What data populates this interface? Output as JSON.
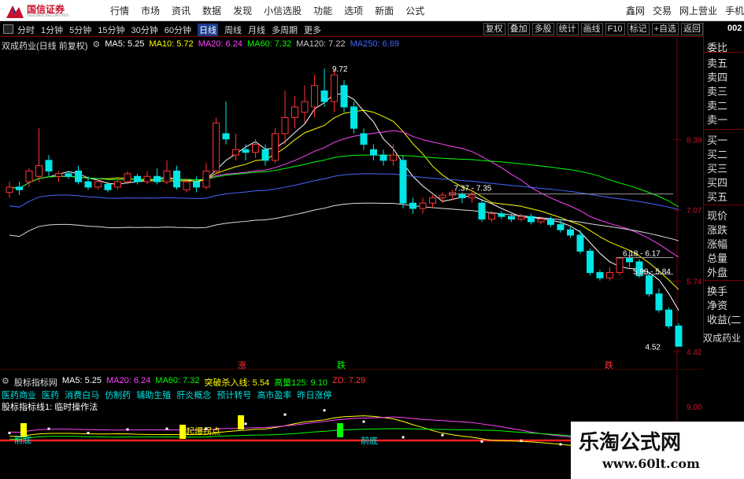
{
  "app": {
    "logo_name": "国信证券",
    "logo_sub": "GUOSEN SECURITIES",
    "main_menu": [
      "行情",
      "市场",
      "资讯",
      "数据",
      "发现",
      "小信选股",
      "功能",
      "选项",
      "新面",
      "公式"
    ],
    "right_menu": [
      "鑫网",
      "交易",
      "网上营业",
      "手机"
    ]
  },
  "toolbar": {
    "periods": [
      "分时",
      "1分钟",
      "5分钟",
      "15分钟",
      "30分钟",
      "60分钟",
      "日线",
      "周线",
      "月线",
      "多周期",
      "更多"
    ],
    "active_period": "日线",
    "tools": [
      "复权",
      "叠加",
      "多股",
      "统计",
      "画线",
      "F10",
      "标记",
      "+自选",
      "返回"
    ]
  },
  "main_chart": {
    "stock_title": "双成药业(日线 前复权)",
    "ma_labels": [
      {
        "text": "MA5: 5.25",
        "color": "#ffffff"
      },
      {
        "text": "MA10: 5.72",
        "color": "#ffff00"
      },
      {
        "text": "MA20: 6.24",
        "color": "#ff44ff"
      },
      {
        "text": "MA60: 7.32",
        "color": "#00ff00"
      },
      {
        "text": "MA120: 7.22",
        "color": "#cccccc"
      },
      {
        "text": "MA250: 6.69",
        "color": "#4466ff"
      }
    ],
    "price_axis": [
      "8.39",
      "7.07",
      "5.74",
      "4.42"
    ],
    "annotations": {
      "high": "9.72",
      "low": "4.52",
      "range1": "7.37 - 7.35",
      "range2": "6.18 - 6.17",
      "range3": "5.90 - 5.84"
    },
    "markers": [
      {
        "text": "涨",
        "color": "#ff3333"
      },
      {
        "text": "跌",
        "color": "#00ff00"
      },
      {
        "text": "跌",
        "color": "#ff3333"
      }
    ]
  },
  "quote_panel": {
    "code": "002",
    "labels": [
      "委比",
      "卖五",
      "卖四",
      "卖三",
      "卖二",
      "卖一",
      "买一",
      "买二",
      "买三",
      "买四",
      "买五",
      "现价",
      "涨跌",
      "涨幅",
      "总量",
      "外盘",
      "换手",
      "净资",
      "收益(二"
    ],
    "stock_name": "双成药业"
  },
  "indicator": {
    "title": "股标指标网",
    "legend": [
      {
        "text": "MA5: 5.25",
        "color": "#ffffff"
      },
      {
        "text": "MA20: 6.24",
        "color": "#ff44ff"
      },
      {
        "text": "MA60: 7.32",
        "color": "#00ff00"
      },
      {
        "text": "突破杀入线: 5.54",
        "color": "#ffff00"
      },
      {
        "text": "高量125: 9.10",
        "color": "#00ff00"
      },
      {
        "text": "ZD: 7.29",
        "color": "#ff3333"
      }
    ],
    "concept_tags": [
      "医药商业",
      "医药",
      "消费白马",
      "仿制药",
      "辅助生殖",
      "肝炎概念",
      "预计转号",
      "高市盈率",
      "昨日涨停"
    ],
    "line_title": "股标指标线1: 临时操作法",
    "axis_top": "9.00",
    "labels": {
      "start": "起爆拐点",
      "bottom1": "前底",
      "bottom2": "前底"
    }
  },
  "watermark": {
    "title": "乐淘公式网",
    "url": "www.60lt.com"
  },
  "chart_data": {
    "type": "candlestick",
    "title": "双成药业(日线 前复权)",
    "ylim": [
      4.2,
      10.0
    ],
    "yticks": [
      8.39,
      7.07,
      5.74,
      4.42
    ],
    "candles": [
      [
        7.4,
        7.5,
        7.3,
        7.6
      ],
      [
        7.5,
        7.45,
        7.35,
        7.6
      ],
      [
        7.6,
        7.8,
        7.5,
        7.85
      ],
      [
        7.7,
        7.9,
        7.6,
        8.6
      ],
      [
        8.0,
        7.8,
        7.7,
        8.1
      ],
      [
        7.7,
        7.75,
        7.6,
        7.8
      ],
      [
        7.75,
        7.7,
        7.65,
        7.8
      ],
      [
        7.8,
        7.6,
        7.55,
        7.9
      ],
      [
        7.6,
        7.5,
        7.45,
        7.7
      ],
      [
        7.5,
        7.6,
        7.45,
        7.65
      ],
      [
        7.55,
        7.45,
        7.4,
        7.6
      ],
      [
        7.5,
        7.6,
        7.45,
        7.65
      ],
      [
        7.6,
        7.75,
        7.55,
        7.8
      ],
      [
        7.7,
        7.6,
        7.55,
        7.75
      ],
      [
        7.6,
        7.7,
        7.55,
        7.8
      ],
      [
        7.7,
        7.6,
        7.55,
        7.85
      ],
      [
        7.6,
        7.8,
        7.55,
        8.0
      ],
      [
        7.8,
        7.5,
        7.45,
        7.9
      ],
      [
        7.45,
        7.6,
        7.4,
        7.65
      ],
      [
        7.6,
        7.5,
        7.4,
        7.7
      ],
      [
        7.5,
        7.8,
        7.45,
        7.95
      ],
      [
        7.8,
        8.7,
        7.75,
        8.8
      ],
      [
        8.5,
        8.4,
        8.3,
        9.1
      ],
      [
        8.1,
        8.2,
        8.0,
        8.5
      ],
      [
        8.2,
        8.15,
        8.0,
        8.3
      ],
      [
        8.15,
        8.3,
        8.05,
        8.4
      ],
      [
        8.2,
        8.0,
        7.9,
        8.3
      ],
      [
        8.0,
        8.5,
        7.95,
        8.6
      ],
      [
        8.5,
        8.8,
        8.3,
        9.3
      ],
      [
        8.8,
        9.0,
        8.6,
        9.2
      ],
      [
        8.9,
        9.1,
        8.7,
        9.4
      ],
      [
        9.0,
        9.4,
        8.8,
        9.6
      ],
      [
        9.3,
        9.1,
        9.0,
        9.72
      ],
      [
        9.1,
        9.6,
        8.9,
        9.7
      ],
      [
        9.4,
        9.0,
        8.9,
        9.5
      ],
      [
        9.0,
        8.6,
        8.5,
        9.1
      ],
      [
        8.5,
        8.3,
        8.2,
        8.6
      ],
      [
        8.2,
        8.1,
        8.0,
        8.3
      ],
      [
        8.1,
        8.0,
        7.9,
        8.2
      ],
      [
        8.0,
        8.1,
        7.9,
        8.3
      ],
      [
        8.0,
        7.2,
        7.1,
        8.1
      ],
      [
        7.2,
        7.1,
        7.0,
        7.3
      ],
      [
        7.1,
        7.2,
        7.0,
        7.3
      ],
      [
        7.2,
        7.3,
        7.1,
        7.35
      ],
      [
        7.3,
        7.35,
        7.2,
        7.4
      ],
      [
        7.35,
        7.4,
        7.25,
        7.45
      ],
      [
        7.37,
        7.3,
        7.2,
        7.4
      ],
      [
        7.3,
        7.35,
        7.2,
        7.45
      ],
      [
        7.2,
        6.9,
        6.85,
        7.25
      ],
      [
        6.9,
        7.0,
        6.85,
        7.05
      ],
      [
        7.0,
        6.95,
        6.9,
        7.05
      ],
      [
        6.95,
        6.9,
        6.85,
        7.0
      ],
      [
        6.9,
        6.95,
        6.85,
        7.0
      ],
      [
        6.95,
        6.85,
        6.8,
        7.0
      ],
      [
        6.85,
        6.9,
        6.8,
        6.95
      ],
      [
        6.9,
        6.8,
        6.75,
        6.95
      ],
      [
        6.8,
        6.7,
        6.65,
        6.9
      ],
      [
        6.7,
        6.6,
        6.55,
        6.75
      ],
      [
        6.6,
        6.3,
        6.25,
        6.7
      ],
      [
        6.3,
        5.9,
        5.85,
        6.35
      ],
      [
        5.9,
        5.8,
        5.75,
        5.95
      ],
      [
        5.8,
        5.9,
        5.75,
        6.0
      ],
      [
        5.9,
        6.17,
        5.85,
        6.2
      ],
      [
        6.18,
        6.1,
        6.0,
        6.3
      ],
      [
        6.1,
        5.84,
        5.8,
        6.15
      ],
      [
        5.84,
        5.5,
        5.45,
        5.9
      ],
      [
        5.5,
        5.2,
        5.15,
        5.6
      ],
      [
        5.2,
        4.9,
        4.85,
        5.25
      ],
      [
        4.9,
        4.52,
        4.52,
        4.95
      ]
    ]
  }
}
